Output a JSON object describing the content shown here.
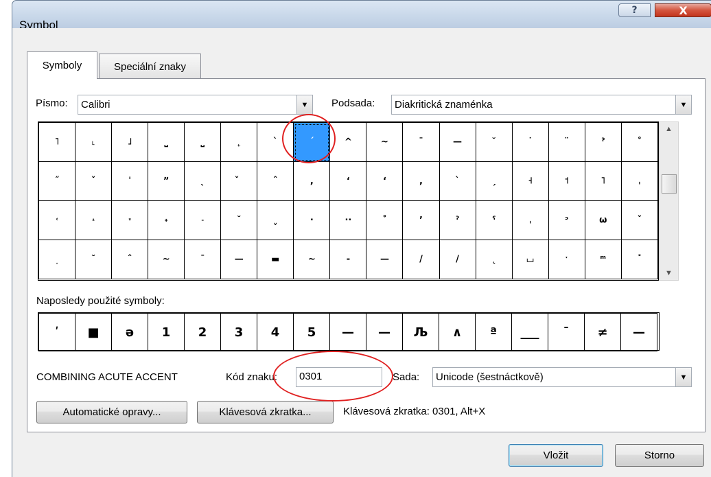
{
  "window": {
    "title": "Symbol",
    "help_label": "?",
    "close_label": "X"
  },
  "tabs": [
    {
      "label": "Symboly",
      "active": true
    },
    {
      "label": "Speciální znaky",
      "active": false
    }
  ],
  "font_selector": {
    "label": "Písmo:",
    "value": "Calibri"
  },
  "subset_selector": {
    "label": "Podsada:",
    "value": "Diakritická znaménka"
  },
  "symbol_grid": {
    "selected_index": 7,
    "cells": [
      "˥",
      "˪",
      "˩",
      "⎵",
      "⎵",
      "˿",
      "ˋ",
      "ˊ",
      "^",
      "~",
      "¯",
      "—",
      "˘",
      "˙",
      "¨",
      "ˀ",
      "˚",
      "˝",
      "ˇ",
      "ˈ",
      "ˮ",
      "ˎ",
      "̌",
      "ˆ",
      ",",
      "ʻ",
      "ʻ",
      ",",
      "ˋ",
      "ˏ",
      "˧",
      "˦",
      "˥",
      "ˌ",
      "˓",
      "˔",
      "˕",
      "˖",
      "˗",
      "˘",
      "ˬ",
      "·",
      "··",
      "˚",
      "ʼ",
      "ˀ",
      "ˁ",
      "ˌ",
      "ᵓ",
      "ω",
      "ˇ",
      "˰",
      "˘",
      "ˆ",
      "~",
      "¯",
      "—",
      "▬",
      "~",
      "-",
      "—",
      "/",
      "/",
      "˛",
      "⌴",
      "ˑ",
      "ᵐ",
      "˟"
    ],
    "scroll_up_icon": "▲",
    "scroll_down_icon": "▼"
  },
  "recent": {
    "label": "Naposledy použité symboly:",
    "cells": [
      "ʹ",
      "■",
      "ə",
      "1",
      "2",
      "3",
      "4",
      "5",
      "—",
      "—",
      "Љ",
      "∧",
      "ª",
      "___",
      "¯",
      "≠",
      "—"
    ]
  },
  "character_name": "COMBINING ACUTE ACCENT",
  "char_code": {
    "label": "Kód znaku:",
    "value": "0301"
  },
  "charset": {
    "label": "Sada:",
    "value": "Unicode (šestnáctkově)"
  },
  "buttons": {
    "autocorrect": "Automatické opravy...",
    "shortcut_key": "Klávesová zkratka...",
    "insert": "Vložit",
    "cancel": "Storno"
  },
  "shortcut_info": "Klávesová zkratka: 0301, Alt+X",
  "dropdown_icon": "▼"
}
